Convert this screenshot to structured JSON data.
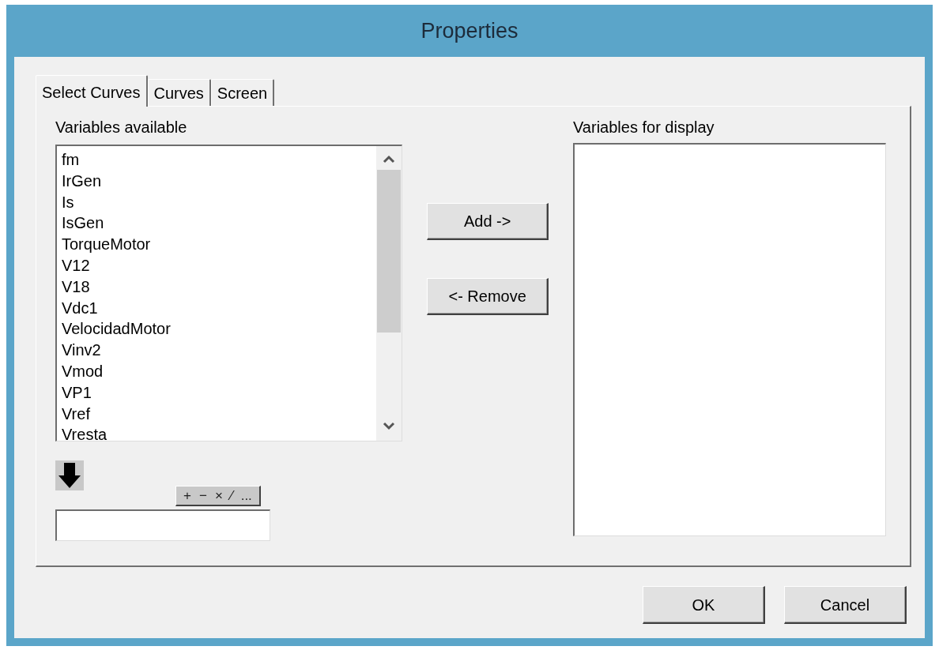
{
  "window": {
    "title": "Properties"
  },
  "tabs": [
    {
      "label": "Select Curves",
      "selected": true
    },
    {
      "label": "Curves",
      "selected": false
    },
    {
      "label": "Screen",
      "selected": false
    }
  ],
  "available": {
    "label": "Variables available",
    "items": [
      "fm",
      "IrGen",
      "Is",
      "IsGen",
      "TorqueMotor",
      "V12",
      "V18",
      "Vdc1",
      "VelocidadMotor",
      "Vinv2",
      "Vmod",
      "VP1",
      "Vref",
      "Vresta"
    ]
  },
  "transfer_buttons": [
    "Add ->",
    "<- Remove"
  ],
  "operators": [
    "+",
    "−",
    "×",
    "⁄",
    "..."
  ],
  "display": {
    "label": "Variables for display"
  },
  "buttons": [
    "OK",
    "Cancel"
  ]
}
